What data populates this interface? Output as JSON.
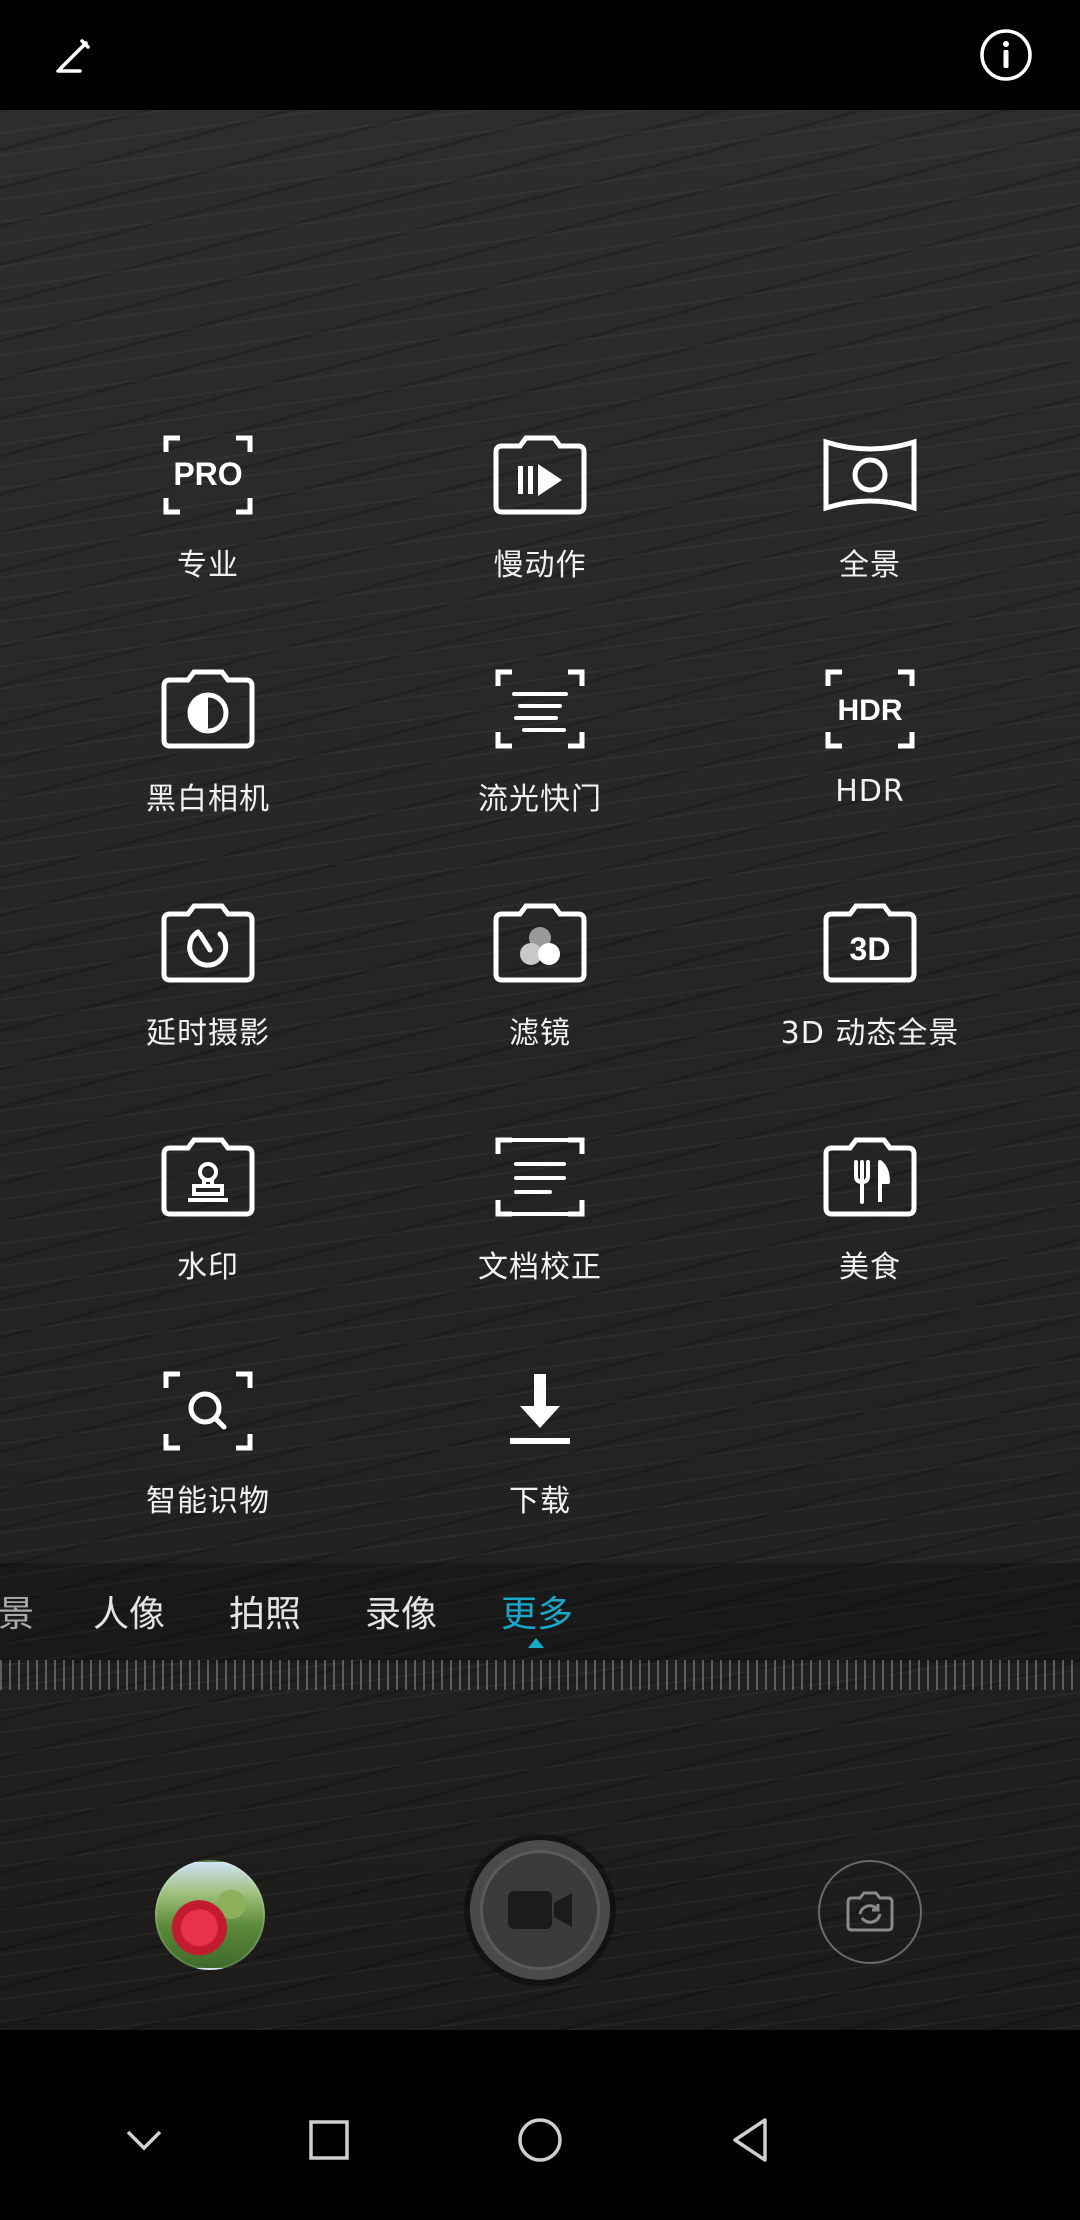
{
  "top_bar": {
    "left_icon": "edit-icon",
    "right_icon": "info-icon"
  },
  "modes": [
    {
      "label": "专业",
      "icon": "pro-mode-icon",
      "glyph": "PRO"
    },
    {
      "label": "慢动作",
      "icon": "slow-motion-icon"
    },
    {
      "label": "全景",
      "icon": "panorama-icon"
    },
    {
      "label": "黑白相机",
      "icon": "monochrome-camera-icon"
    },
    {
      "label": "流光快门",
      "icon": "light-painting-icon"
    },
    {
      "label": "HDR",
      "icon": "hdr-icon",
      "glyph": "HDR"
    },
    {
      "label": "延时摄影",
      "icon": "time-lapse-icon"
    },
    {
      "label": "滤镜",
      "icon": "filter-icon"
    },
    {
      "label": "3D 动态全景",
      "icon": "3d-panorama-icon",
      "glyph": "3D"
    },
    {
      "label": "水印",
      "icon": "watermark-icon"
    },
    {
      "label": "文档校正",
      "icon": "document-scan-icon"
    },
    {
      "label": "美食",
      "icon": "food-icon"
    },
    {
      "label": "智能识物",
      "icon": "object-recognition-icon"
    },
    {
      "label": "下载",
      "icon": "download-icon"
    }
  ],
  "mode_bar": {
    "partial_tab": "景",
    "tabs": [
      "人像",
      "拍照",
      "录像",
      "更多"
    ],
    "active": "更多",
    "accent_color": "#1aa8c9"
  },
  "controls": {
    "gallery_thumbnail": "gallery-thumbnail",
    "shutter_icon": "video-camera-icon",
    "switch_icon": "switch-camera-icon"
  },
  "nav_bar": [
    "chevron-down-icon",
    "recents-icon",
    "home-icon",
    "back-icon"
  ]
}
